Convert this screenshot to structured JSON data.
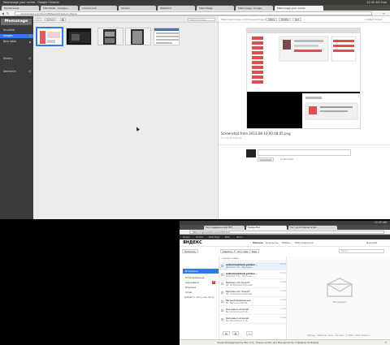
{
  "top": {
    "titlebar": "Memonage your online - Google Chrome",
    "clock": "12:45 AM",
    "tray_user": "Ema",
    "tabs": [
      "Расписание",
      "Macintosh - Google+",
      "yoururl.com",
      "Yandex",
      "Webstore",
      "MemoPage",
      "Memonage, Google",
      "Memonage your online"
    ],
    "active_tab": "Memonage your online",
    "url": "memonage.com/foo/34fbfe/andme/by/1r/fresh",
    "sidebar": {
      "logo": "Memonage",
      "items": [
        {
          "label": "Uncalled"
        },
        {
          "label": "Images",
          "count": "9"
        },
        {
          "label": "New table"
        },
        {
          "label": "History"
        },
        {
          "label": "DanishOn"
        }
      ]
    },
    "toolbar": {
      "upload_label": "Upload",
      "search_placeholder": "Search Images ..."
    },
    "preview": {
      "link": "http://memonage.com/Unsaved/image/fresh",
      "actions": [
        "Share",
        "Delete",
        "Get"
      ],
      "right_label": "Untitled Screen",
      "filename": "Screenshot from 2013-08-10 00:48:05.png",
      "date": "10 Aug 2013 00:48",
      "comment_button": "Comment",
      "comment_as": "as DanishOn"
    }
  },
  "mail": {
    "clock": "12:45 AM",
    "tabs": [
      "Тех поддержка для РНР...",
      "Yandex.Mail",
      "Тест_дозт/пресентатив..."
    ],
    "active_tab": "Yandex.Mail",
    "url": "https://mail.yandex.ru/neo2/#inbox",
    "search_bar": [
      "Поиск",
      "Почта",
      "Мой Круг",
      "Mail",
      "Фото"
    ],
    "logo": "ЯНДЕКС",
    "nav": [
      "Письма",
      "Контакты",
      "Файлы",
      "Мои подписки"
    ],
    "user": "Джозеф",
    "toolbar": [
      "Написать",
      "Удалить",
      "Это спам",
      "Ещё"
    ],
    "search_placeholder": "Поиск",
    "compose": "Написать",
    "folders": [
      {
        "label": "Входящие",
        "count": ""
      },
      {
        "label": "Отправленные",
        "count": ""
      },
      {
        "label": "Черновики",
        "count": "3"
      },
      {
        "label": "Корзина",
        "count": ""
      },
      {
        "label": "Спам",
        "count": ""
      }
    ],
    "new_folder": "Добавить папку или метку",
    "list_header": "Сначала новые",
    "messages": [
      {
        "from": "webmina@desk.yandex...",
        "subject": "Jpeartest.com - Крупные...",
        "date": "10:44"
      },
      {
        "from": "webmina@desk.yandex...",
        "subject": "Jpeartest.com - Крупные...",
        "date": "10:44"
      },
      {
        "from": "ByChess.com Support",
        "subject": "Re: По  ByChess Крупный",
        "date": "9 мая"
      },
      {
        "from": "ByChess.com Support",
        "subject": "Re: По  ByChess Крупный",
        "date": "9 мая"
      },
      {
        "from": "Евгений Шереметьев",
        "subject": "Re: Welcome vehicle",
        "date": "9 мая"
      },
      {
        "from": "Беломенко Алексей",
        "subject": "Re: Оплатить в 3 сф...",
        "date": "9 мая"
      },
      {
        "from": "Беломенко Алексей",
        "subject": "Re: Оплатить в 3 сф...",
        "date": "8 мая"
      }
    ],
    "empty_state": "Входящие",
    "footer": "Помощь · Обратная связь · Реклама · © 2001—2013 «Яндекс»",
    "download_bar": "Ученик Беседерниуб by Misc.com · Ученик на Мои на 1 Все дисках Ки отправлен Кл Бланка"
  }
}
